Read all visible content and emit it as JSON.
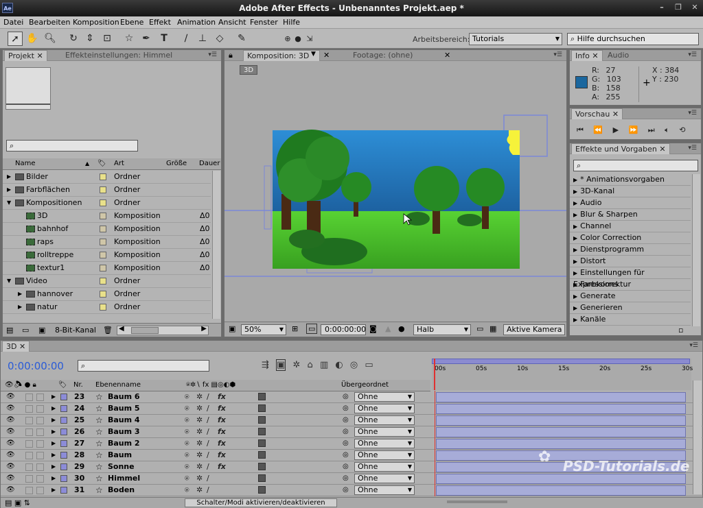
{
  "app": {
    "title": "Adobe After Effects - Unbenanntes Projekt.aep *",
    "icon": "Ae"
  },
  "menu": [
    "Datei",
    "Bearbeiten",
    "Komposition",
    "Ebene",
    "Effekt",
    "Animation",
    "Ansicht",
    "Fenster",
    "Hilfe"
  ],
  "toolbar": {
    "workspace_label": "Arbeitsbereich:",
    "workspace_value": "Tutorials",
    "help_placeholder": "Hilfe durchsuchen"
  },
  "project": {
    "tabs": [
      "Projekt",
      "Effekteinstellungen: Himmel"
    ],
    "columns": [
      "Name",
      "Art",
      "Größe",
      "Dauer"
    ],
    "items": [
      {
        "name": "Bilder",
        "type": "Ordner",
        "kind": "folder",
        "indent": 0,
        "color": "#e8e08a",
        "dur": ""
      },
      {
        "name": "Farbflächen",
        "type": "Ordner",
        "kind": "folder",
        "indent": 0,
        "color": "#e8e08a",
        "dur": ""
      },
      {
        "name": "Kompositionen",
        "type": "Ordner",
        "kind": "folder",
        "indent": 0,
        "color": "#e8e08a",
        "dur": "",
        "open": true
      },
      {
        "name": "3D",
        "type": "Komposition",
        "kind": "comp",
        "indent": 1,
        "color": "#cfc6a8",
        "dur": "Δ0"
      },
      {
        "name": "bahnhof",
        "type": "Komposition",
        "kind": "comp",
        "indent": 1,
        "color": "#cfc6a8",
        "dur": "Δ0"
      },
      {
        "name": "raps",
        "type": "Komposition",
        "kind": "comp",
        "indent": 1,
        "color": "#cfc6a8",
        "dur": "Δ0"
      },
      {
        "name": "rolltreppe",
        "type": "Komposition",
        "kind": "comp",
        "indent": 1,
        "color": "#cfc6a8",
        "dur": "Δ0"
      },
      {
        "name": "textur1",
        "type": "Komposition",
        "kind": "comp",
        "indent": 1,
        "color": "#cfc6a8",
        "dur": "Δ0"
      },
      {
        "name": "Video",
        "type": "Ordner",
        "kind": "folder",
        "indent": 0,
        "color": "#e8e08a",
        "dur": "",
        "open": true
      },
      {
        "name": "hannover",
        "type": "Ordner",
        "kind": "folder",
        "indent": 1,
        "color": "#e8e08a",
        "dur": ""
      },
      {
        "name": "natur",
        "type": "Ordner",
        "kind": "folder",
        "indent": 1,
        "color": "#e8e08a",
        "dur": ""
      }
    ],
    "footer": "8-Bit-Kanal"
  },
  "composition": {
    "tabs": [
      "Komposition: 3D",
      "Footage: (ohne)"
    ],
    "chip": "3D",
    "zoom": "50%",
    "timecode": "0:00:00:00",
    "resolution": "Halb",
    "camera": "Aktive Kamera"
  },
  "info": {
    "tabs": [
      "Info",
      "Audio"
    ],
    "r_label": "R:",
    "r": "27",
    "g_label": "G:",
    "g": "103",
    "b_label": "B:",
    "b": "158",
    "a_label": "A:",
    "a": "255",
    "x_label": "X :",
    "x": "384",
    "y_label": "Y :",
    "y": "230",
    "swatch_color": "#1b679e"
  },
  "preview": {
    "tab": "Vorschau"
  },
  "effects": {
    "tab": "Effekte und Vorgaben",
    "items": [
      "* Animationsvorgaben",
      "3D-Kanal",
      "Audio",
      "Blur & Sharpen",
      "Channel",
      "Color Correction",
      "Dienstprogramm",
      "Distort",
      "Einstellungen für Expressions",
      "Farbkorrektur",
      "Generate",
      "Generieren",
      "Kanäle"
    ]
  },
  "timeline": {
    "tab": "3D",
    "timecode": "0:00:00:00",
    "col_nr": "Nr.",
    "col_name": "Ebenenname",
    "col_parent": "Übergeordnet",
    "ruler": [
      "00s",
      "05s",
      "10s",
      "15s",
      "20s",
      "25s",
      "30s"
    ],
    "layers": [
      {
        "nr": "23",
        "name": "Baum 6",
        "fx": true,
        "parent": "Ohne"
      },
      {
        "nr": "24",
        "name": "Baum 5",
        "fx": true,
        "parent": "Ohne"
      },
      {
        "nr": "25",
        "name": "Baum 4",
        "fx": true,
        "parent": "Ohne"
      },
      {
        "nr": "26",
        "name": "Baum 3",
        "fx": true,
        "parent": "Ohne"
      },
      {
        "nr": "27",
        "name": "Baum 2",
        "fx": true,
        "parent": "Ohne"
      },
      {
        "nr": "28",
        "name": "Baum",
        "fx": true,
        "parent": "Ohne"
      },
      {
        "nr": "29",
        "name": "Sonne",
        "fx": true,
        "parent": "Ohne"
      },
      {
        "nr": "30",
        "name": "Himmel",
        "fx": false,
        "parent": "Ohne"
      },
      {
        "nr": "31",
        "name": "Boden",
        "fx": false,
        "parent": "Ohne"
      }
    ],
    "footer": "Schalter/Modi aktivieren/deaktivieren"
  },
  "watermark": "PSD-Tutorials.de"
}
